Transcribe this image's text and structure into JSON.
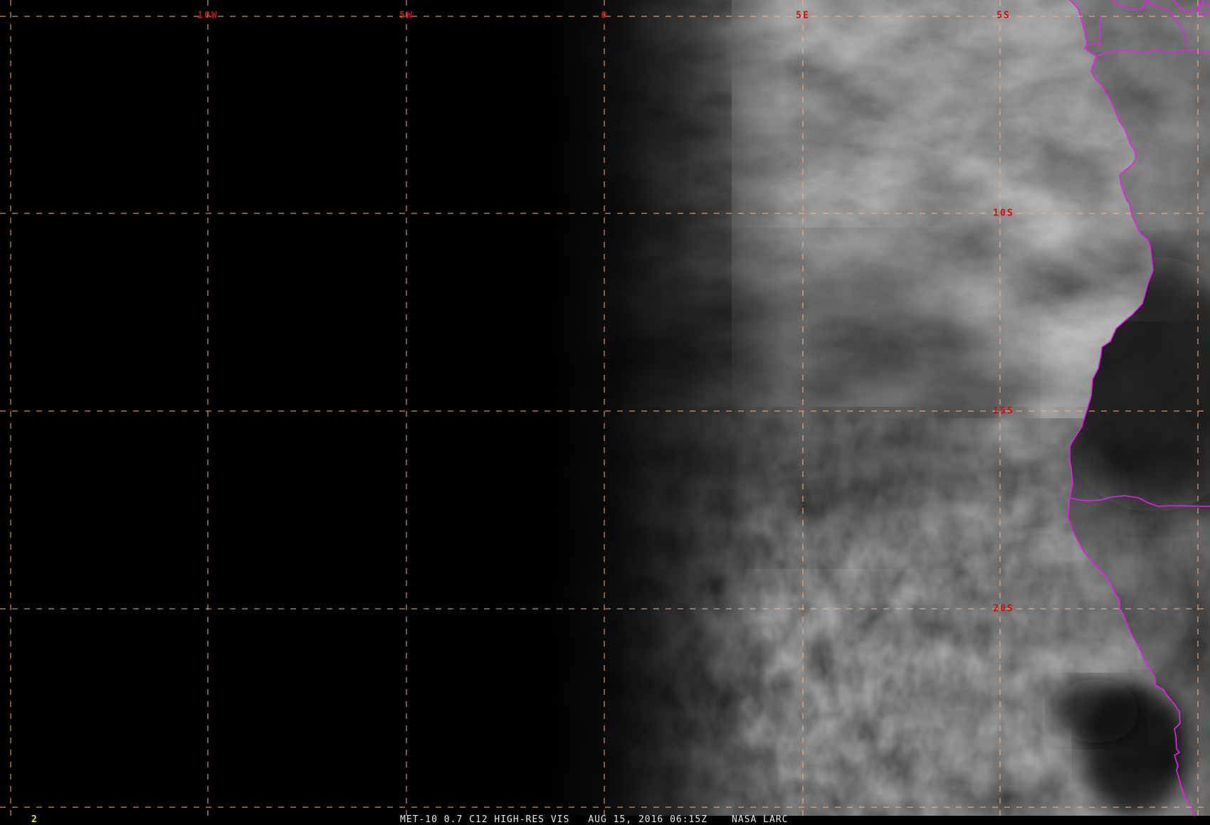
{
  "image_overlay": {
    "longitude_labels": [
      {
        "text": "10W"
      },
      {
        "text": "5W"
      },
      {
        "text": "0"
      },
      {
        "text": "5E"
      }
    ],
    "latitude_labels": [
      {
        "text": "5S"
      },
      {
        "text": "10S"
      },
      {
        "text": "15S"
      },
      {
        "text": "20S"
      }
    ]
  },
  "caption": {
    "product": "MET-10 0.7 C12 HIGH-RES VIS",
    "timestamp": "AUG 15, 2016 06:15Z",
    "credit": "NASA LARC"
  },
  "frame_counter": "2",
  "colors": {
    "background": "#000000",
    "grid_line": "#f9b287",
    "coordinate_label": "#d01010",
    "coastline": "#ee1cee",
    "caption_text": "#e8e8e8",
    "frame_counter": "#e6e600"
  }
}
